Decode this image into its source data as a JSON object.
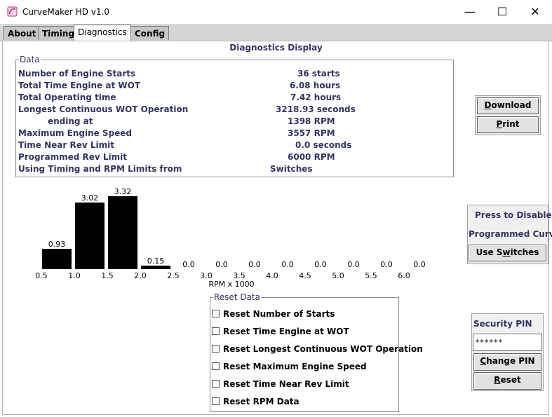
{
  "window": {
    "title": "CurveMaker HD v1.0",
    "minimize_glyph": "—",
    "maximize_glyph": "☐",
    "close_glyph": "✕",
    "app_icon": "curvemaker-app-icon"
  },
  "tabs": [
    {
      "label": "About",
      "active": false
    },
    {
      "label": "Timing",
      "active": false
    },
    {
      "label": "Diagnostics",
      "active": true
    },
    {
      "label": "Config",
      "active": false
    }
  ],
  "panel_title": "Diagnostics Display",
  "data_group": {
    "legend": "Data",
    "rows": [
      {
        "label": "Number of Engine Starts",
        "value": "36 starts"
      },
      {
        "label": "Total Time Engine at WOT",
        "value": "6.08 hours"
      },
      {
        "label": "Total Operating time",
        "value": "7.42 hours"
      },
      {
        "label": "Longest Continuous WOT Operation",
        "value": "3218.93 seconds"
      },
      {
        "label": "ending at",
        "value": "1398 RPM"
      },
      {
        "label": "Maximum Engine Speed",
        "value": "3557 RPM"
      },
      {
        "label": "Time Near Rev Limit",
        "value": "0.0 seconds"
      },
      {
        "label": "Programmed Rev Limit",
        "value": "6000 RPM"
      },
      {
        "label": "Using Timing and RPM Limits from",
        "value": "Switches"
      }
    ]
  },
  "buttons": {
    "download": "Download",
    "download_mnemonic": "D",
    "print": "Print",
    "print_mnemonic": "P",
    "disable_line1": "Press to Disable",
    "disable_line2": "Programmed Curve",
    "use_switches_pre": "Use S",
    "use_switches_mnemonic": "w",
    "use_switches_post": "itches",
    "change_pin_pre": "",
    "change_pin_mnemonic": "C",
    "change_pin_post": "hange PIN",
    "reset_pre": "",
    "reset_mnemonic": "R",
    "reset_post": "eset"
  },
  "security": {
    "label": "Security PIN",
    "pin_value": "******"
  },
  "reset_group": {
    "legend": "Reset Data",
    "items": [
      {
        "label": "Reset Number of Starts",
        "checked": false
      },
      {
        "label": "Reset Time Engine at WOT",
        "checked": false
      },
      {
        "label": "Reset Longest Continuous WOT Operation",
        "checked": false
      },
      {
        "label": "Reset Maximum Engine Speed",
        "checked": false
      },
      {
        "label": "Reset Time Near Rev Limit",
        "checked": false
      },
      {
        "label": "Reset RPM Data",
        "checked": false
      }
    ]
  },
  "chart_data": {
    "type": "bar",
    "categories": [
      "0.5-1.0",
      "1.0-1.5",
      "1.5-2.0",
      "2.0-2.5",
      "2.5-3.0",
      "3.0-3.5",
      "3.5-4.0",
      "4.0-4.5",
      "4.5-5.0",
      "5.0-5.5",
      "5.5-6.0",
      "6.0-6.5"
    ],
    "values": [
      0.93,
      3.02,
      3.32,
      0.15,
      0.0,
      0.0,
      0.0,
      0.0,
      0.0,
      0.0,
      0.0,
      0.0
    ],
    "value_labels": [
      "0.93",
      "3.02",
      "3.32",
      "0.15",
      "0.0",
      "0.0",
      "0.0",
      "0.0",
      "0.0",
      "0.0",
      "0.0",
      "0.0"
    ],
    "x_ticks": [
      "0.5",
      "1.0",
      "1.5",
      "2.0",
      "2.5",
      "3.0",
      "3.5",
      "4.0",
      "4.5",
      "5.0",
      "5.5",
      "6.0"
    ],
    "xlabel": "RPM x 1000",
    "ylabel": "",
    "title": "",
    "ylim": [
      0,
      3.32
    ],
    "bar_color": "#000000",
    "grid": false,
    "legend": "none"
  }
}
